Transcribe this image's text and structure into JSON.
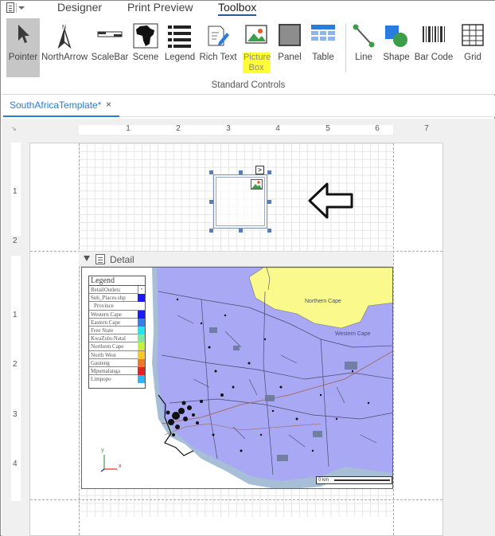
{
  "tabs": {
    "designer": "Designer",
    "print_preview": "Print Preview",
    "toolbox": "Toolbox"
  },
  "ribbon": {
    "tools": [
      {
        "label": "Pointer",
        "icon": "pointer-icon"
      },
      {
        "label": "NorthArrow",
        "icon": "north-arrow-icon"
      },
      {
        "label": "ScaleBar",
        "icon": "scale-bar-icon"
      },
      {
        "label": "Scene",
        "icon": "africa-map-icon"
      },
      {
        "label": "Legend",
        "icon": "legend-icon"
      },
      {
        "label": "Rich Text",
        "icon": "rich-text-icon"
      },
      {
        "label": "Picture Box",
        "icon": "picture-icon"
      },
      {
        "label": "Panel",
        "icon": "panel-icon"
      },
      {
        "label": "Table",
        "icon": "table-icon"
      },
      {
        "label": "Line",
        "icon": "line-icon"
      },
      {
        "label": "Shape",
        "icon": "shape-icon"
      },
      {
        "label": "Bar Code",
        "icon": "barcode-icon"
      },
      {
        "label": "Grid",
        "icon": "grid-icon"
      }
    ],
    "group_label": "Standard Controls"
  },
  "document_tab": {
    "title": "SouthAfricaTemplate*",
    "close": "×"
  },
  "ruler": {
    "h": [
      "1",
      "2",
      "3",
      "4",
      "5",
      "6",
      "7"
    ],
    "v_top": [
      "1",
      "2"
    ],
    "v_detail": [
      "1",
      "2",
      "3",
      "4"
    ]
  },
  "band": {
    "title": "Detail"
  },
  "map": {
    "legend_title": "Legend",
    "legend_rows": [
      {
        "label": "RetailOutlets",
        "color": ""
      },
      {
        "label": "Sub_Places.shp",
        "color": "#1a1aff"
      },
      {
        "label": "Province",
        "color": ""
      },
      {
        "label": "Western Cape",
        "color": "#1a1aff"
      },
      {
        "label": "Eastern Cape",
        "color": "#3b7be8"
      },
      {
        "label": "Free State",
        "color": "#22e5f0"
      },
      {
        "label": "KwaZulu-Natal",
        "color": "#7de89a"
      },
      {
        "label": "Northern Cape",
        "color": "#c8ef3a"
      },
      {
        "label": "North West",
        "color": "#f6c82a"
      },
      {
        "label": "Gauteng",
        "color": "#f0762a"
      },
      {
        "label": "Mpumalanga",
        "color": "#e82020"
      },
      {
        "label": "Limpopo",
        "color": "#2fb5f5"
      }
    ],
    "region_labels": [
      "Northern Cape",
      "Western Cape"
    ],
    "scalebar_label": "0 km",
    "axis_x": "x",
    "axis_y": "y"
  },
  "colors": {
    "accent": "#2b7cd3",
    "highlight": "#ffff33",
    "map_land": "#a8a8f5",
    "map_sea": "#a6bfd6",
    "northern_cape": "#fafa8c"
  }
}
